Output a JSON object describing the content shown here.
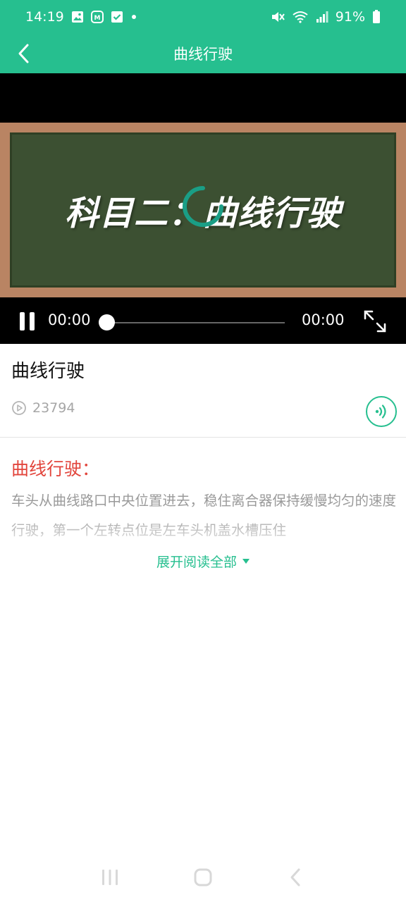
{
  "status_bar": {
    "time": "14:19",
    "battery": "91%",
    "icons": [
      "gallery-icon",
      "app-notification-icon",
      "check-icon",
      "dot-icon",
      "mute-icon",
      "wifi-icon",
      "signal-icon",
      "battery-icon"
    ]
  },
  "header": {
    "title": "曲线行驶",
    "back_icon": "chevron-left-icon"
  },
  "video": {
    "board_text": "科目二：曲线行驶",
    "current_time": "00:00",
    "total_time": "00:00",
    "progress": 0,
    "state": "loading",
    "colors": {
      "board": "#3c5032",
      "frame": "#b98463",
      "spinner": "#1a9e86"
    }
  },
  "info": {
    "title": "曲线行驶",
    "view_count": "23794",
    "audio_icon": "audio-wave-icon"
  },
  "article": {
    "heading": "曲线行驶：",
    "body": "车头从曲线路口中央位置进去，稳住离合器保持缓慢均匀的速度行驶，第一个左转点位是左车头机盖水槽压住",
    "expand_label": "展开阅读全部"
  },
  "theme": {
    "accent": "#26bf8f",
    "heading_red": "#e2453c"
  }
}
